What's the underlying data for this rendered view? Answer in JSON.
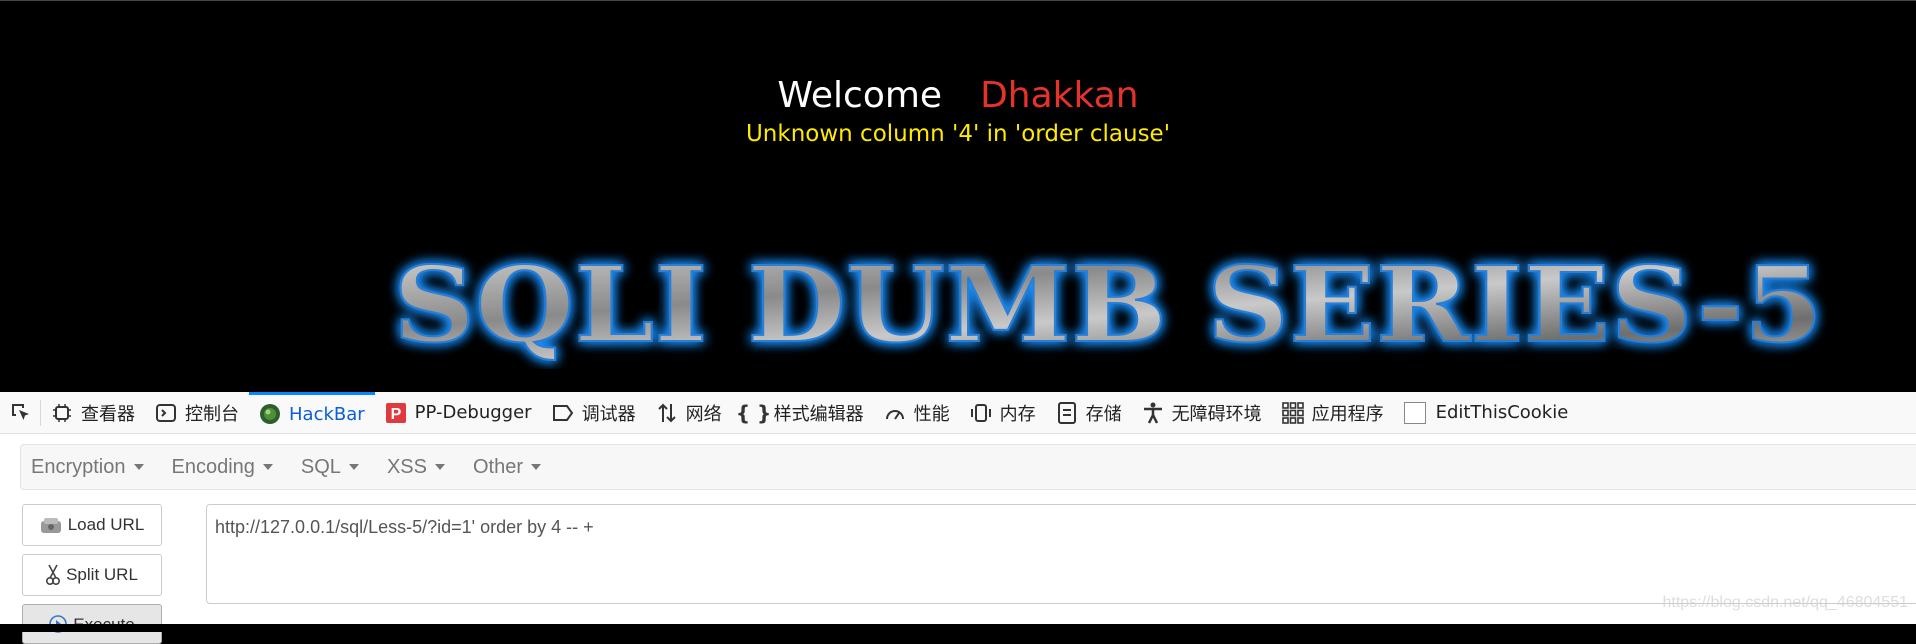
{
  "page": {
    "welcome_label": "Welcome",
    "username": "Dhakkan",
    "error_message": "Unknown column '4' in 'order clause'",
    "banner_text": "SQLI DUMB SERIES-5"
  },
  "devtools": {
    "tabs": [
      {
        "label": "查看器",
        "icon": "inspector-icon"
      },
      {
        "label": "控制台",
        "icon": "console-icon"
      },
      {
        "label": "HackBar",
        "icon": "hackbar-icon",
        "active": true
      },
      {
        "label": "PP-Debugger",
        "icon": "pp-debugger-icon"
      },
      {
        "label": "调试器",
        "icon": "debugger-icon"
      },
      {
        "label": "网络",
        "icon": "network-icon"
      },
      {
        "label": "样式编辑器",
        "icon": "style-editor-icon"
      },
      {
        "label": "性能",
        "icon": "performance-icon"
      },
      {
        "label": "内存",
        "icon": "memory-icon"
      },
      {
        "label": "存储",
        "icon": "storage-icon"
      },
      {
        "label": "无障碍环境",
        "icon": "accessibility-icon"
      },
      {
        "label": "应用程序",
        "icon": "application-icon"
      },
      {
        "label": "EditThisCookie",
        "icon": "checkbox-icon"
      }
    ]
  },
  "hackbar": {
    "menus": [
      "Encryption",
      "Encoding",
      "SQL",
      "XSS",
      "Other"
    ],
    "buttons": {
      "load_url": "Load URL",
      "split_url": "Split URL",
      "execute": "Execute"
    },
    "url": "http://127.0.0.1/sql/Less-5/?id=1' order by 4 -- +"
  },
  "watermark": "https://blog.csdn.net/qq_46804551",
  "colors": {
    "username": "#e6332a",
    "error": "#ffea00",
    "active_tab": "#0a84ff",
    "banner_glow": "#1e90ff"
  }
}
